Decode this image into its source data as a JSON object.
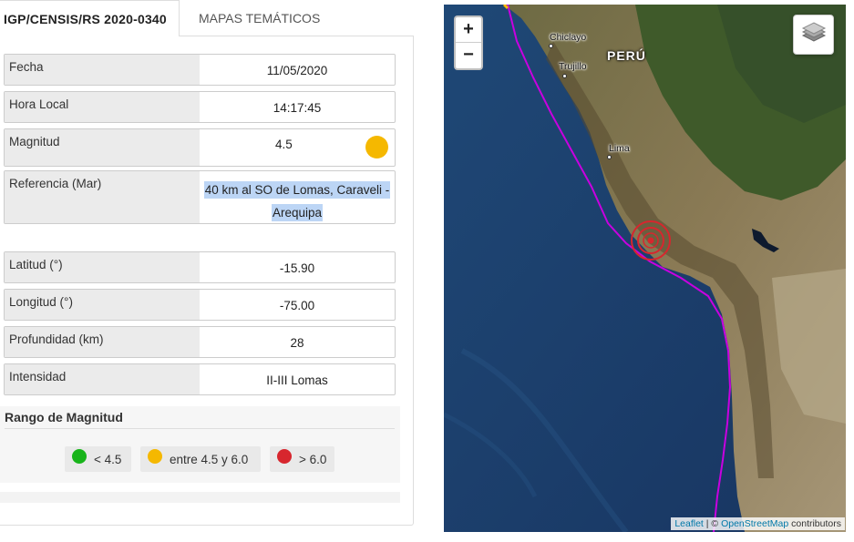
{
  "tabs": [
    {
      "label": "IGP/CENSIS/RS 2020-0340",
      "active": true
    },
    {
      "label": "MAPAS TEMÁTICOS",
      "active": false
    }
  ],
  "details": [
    {
      "label": "Fecha",
      "value": "11/05/2020"
    },
    {
      "label": "Hora Local",
      "value": "14:17:45"
    },
    {
      "label": "Magnitud",
      "value": "4.5",
      "indicator_color": "#f5b800"
    },
    {
      "label": "Referencia (Mar)",
      "value": "40 km al SO de Lomas, Caraveli -",
      "value_line2": "Arequipa"
    },
    {
      "label": "Latitud (°)",
      "value": "-15.90"
    },
    {
      "label": "Longitud (°)",
      "value": "-75.00"
    },
    {
      "label": "Profundidad (km)",
      "value": "28"
    },
    {
      "label": "Intensidad",
      "value": "II-III Lomas"
    }
  ],
  "range": {
    "title": "Rango de Magnitud",
    "items": [
      {
        "label": "< 4.5",
        "color": "#18b41a"
      },
      {
        "label": "entre 4.5 y 6.0",
        "color": "#f5b800"
      },
      {
        "label": "> 6.0",
        "color": "#d7262e"
      }
    ]
  },
  "map": {
    "zoom_in": "+",
    "zoom_out": "−",
    "layers_icon": "layers-icon",
    "country_label": "PERÚ",
    "cities": [
      "Chiclayo",
      "Trujillo",
      "Lima"
    ],
    "epicenter_color": "#d7262e",
    "trench_color": "#c800e0",
    "attribution": {
      "leaflet": "Leaflet",
      "sep": " | © ",
      "osm": "OpenStreetMap",
      "suffix": " contributors"
    }
  },
  "colors": {
    "accent_blue": "#0078a8",
    "highlight": "#bcd5f5"
  }
}
